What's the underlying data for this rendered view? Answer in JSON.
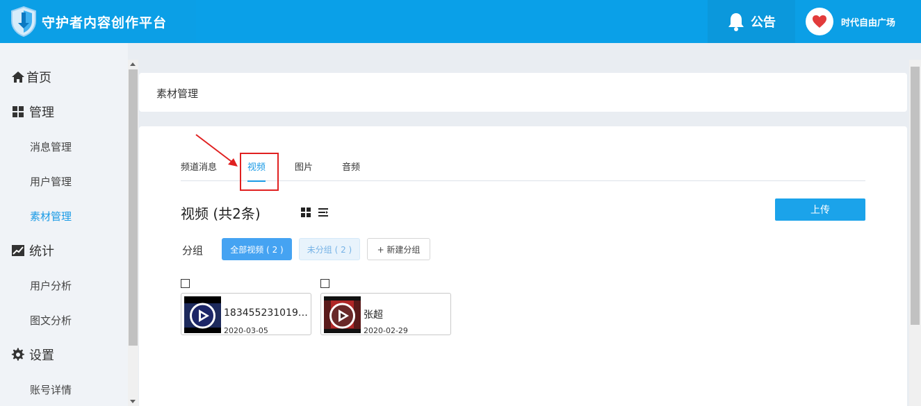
{
  "header": {
    "app_title": "守护者内容创作平台",
    "notice_label": "公告",
    "username": "时代自由广场",
    "accent_color": "#0aa0e8"
  },
  "sidebar": {
    "items": [
      {
        "label": "首页",
        "icon": "home-icon"
      },
      {
        "label": "管理",
        "icon": "grid-icon"
      },
      {
        "label": "消息管理"
      },
      {
        "label": "用户管理"
      },
      {
        "label": "素材管理",
        "active": true
      },
      {
        "label": "统计",
        "icon": "chart-icon"
      },
      {
        "label": "用户分析"
      },
      {
        "label": "图文分析"
      },
      {
        "label": "设置",
        "icon": "gear-icon"
      },
      {
        "label": "账号详情"
      }
    ]
  },
  "breadcrumb": "素材管理",
  "tabs": [
    {
      "label": "频道消息"
    },
    {
      "label": "视频",
      "active": true
    },
    {
      "label": "图片"
    },
    {
      "label": "音频"
    }
  ],
  "section": {
    "title": "视频 (共2条)",
    "upload_label": "上传"
  },
  "groups": {
    "label": "分组",
    "all": "全部视频 ( 2 )",
    "ungrouped": "未分组 ( 2 )",
    "new_group": "+ 新建分组"
  },
  "videos": [
    {
      "title": "1834552310199...",
      "date": "2020-03-05"
    },
    {
      "title": "张超",
      "date": "2020-02-29"
    }
  ]
}
